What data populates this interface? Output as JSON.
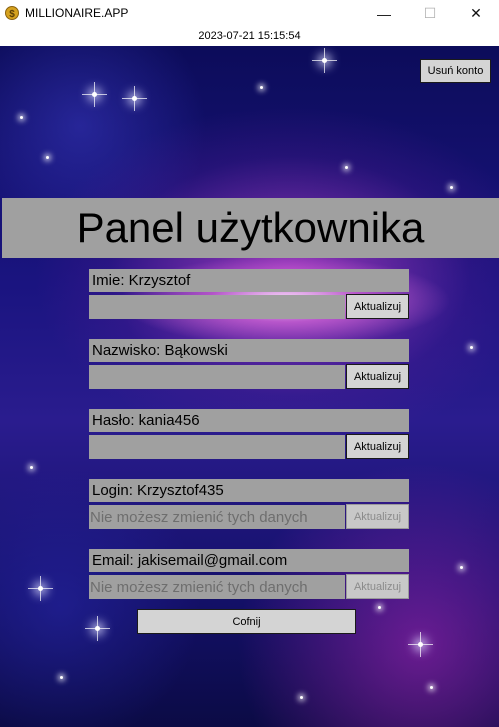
{
  "window": {
    "title": "MILLIONAIRE.APP",
    "icon": "dollar-coin-icon",
    "controls": {
      "minimize": "—",
      "maximize": "☐",
      "close": "✕"
    }
  },
  "datetime": "2023-07-21 15:15:54",
  "account": {
    "delete_label": "Usuń konto"
  },
  "panel": {
    "title": "Panel użytkownika"
  },
  "fields": [
    {
      "label": "Imie: Krzysztof",
      "value": "",
      "placeholder": "",
      "button": "Aktualizuj",
      "editable": true
    },
    {
      "label": "Nazwisko: Bąkowski",
      "value": "",
      "placeholder": "",
      "button": "Aktualizuj",
      "editable": true
    },
    {
      "label": "Hasło: kania456",
      "value": "",
      "placeholder": "",
      "button": "Aktualizuj",
      "editable": true
    },
    {
      "label": "Login: Krzysztof435",
      "value": "",
      "placeholder": "Nie możesz zmienić tych danych",
      "button": "Aktualizuj",
      "editable": false
    },
    {
      "label": "Email: jakisemail@gmail.com",
      "value": "",
      "placeholder": "Nie możesz zmienić tych danych",
      "button": "Aktualizuj",
      "editable": false
    }
  ],
  "back_label": "Cofnij",
  "colors": {
    "panel_gray": "#a0a0a0",
    "button_gray": "#d4d4d4",
    "accent_gold": "#d6a21e"
  }
}
